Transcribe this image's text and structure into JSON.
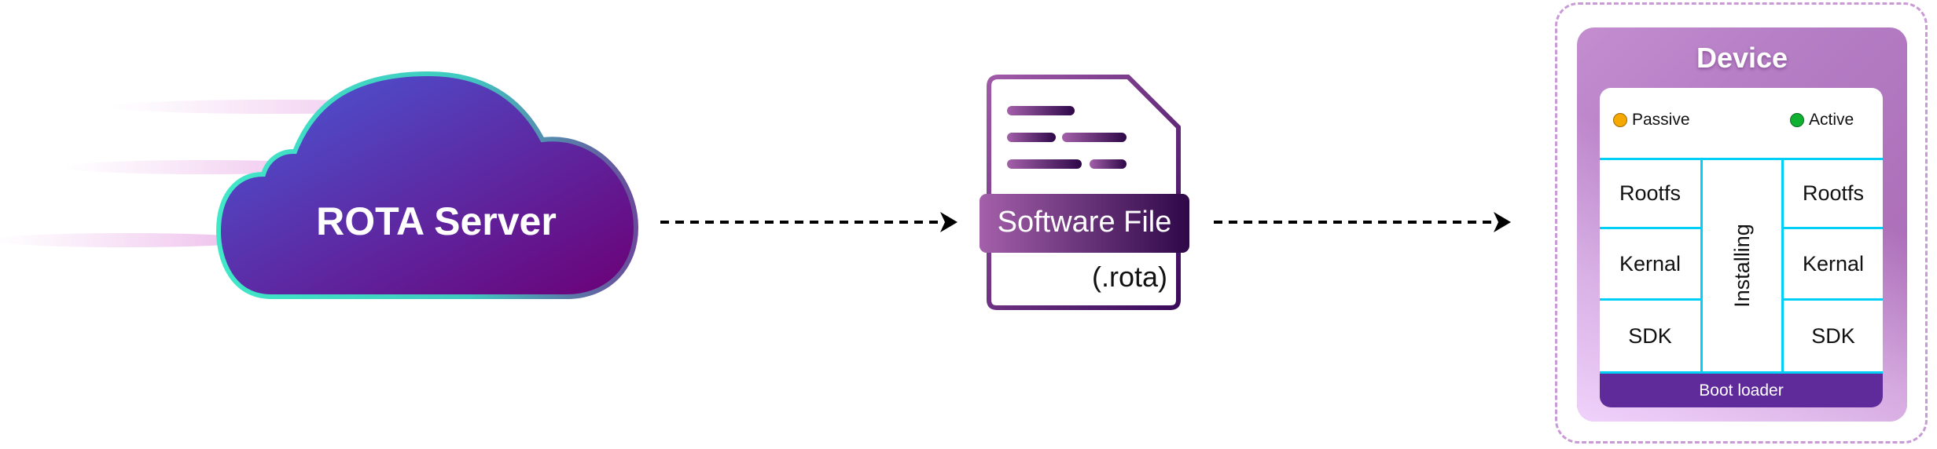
{
  "server": {
    "label": "ROTA Server"
  },
  "file": {
    "label": "Software File",
    "extension": "(.rota)"
  },
  "device": {
    "title": "Device",
    "legend": [
      {
        "label": "Passive",
        "color": "#f5a800"
      },
      {
        "label": "Active",
        "color": "#10b030"
      }
    ],
    "left_partition": [
      "Rootfs",
      "Kernal",
      "SDK"
    ],
    "right_partition": [
      "Rootfs",
      "Kernal",
      "SDK"
    ],
    "middle_label": "Installing",
    "boot_label": "Boot loader"
  },
  "colors": {
    "accent_cyan": "#00d0f5",
    "boot_purple": "#5f2a9a",
    "cloud_start": "#4a5ad8",
    "cloud_end": "#6c0076",
    "cloud_outline": "#40e8c8"
  }
}
